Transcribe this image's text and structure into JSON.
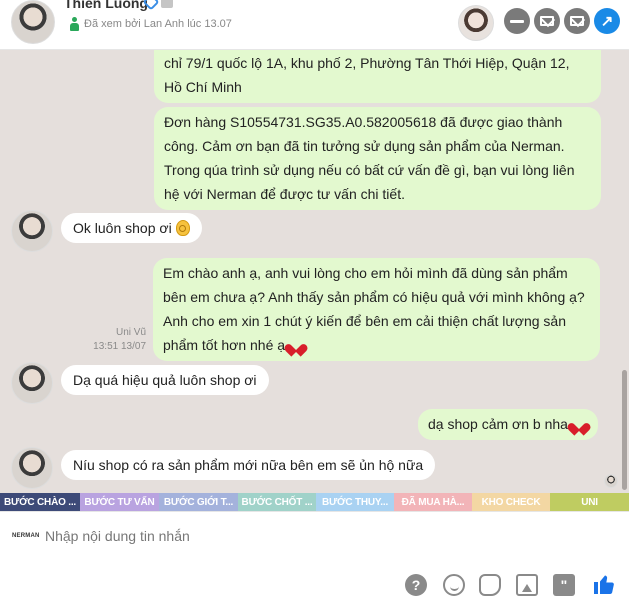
{
  "header": {
    "name": "Thien Luong",
    "seen_status": "Đã xem bởi Lan Anh lúc 13.07",
    "buttons": [
      "minus-icon",
      "mail-icon",
      "forward-mail-icon",
      "share-arrow-icon"
    ]
  },
  "messages": [
    {
      "direction": "out",
      "text": "chỉ 79/1 quốc lộ 1A, khu phố 2, Phường Tân Thới Hiệp, Quận 12, Hồ Chí Minh"
    },
    {
      "direction": "out",
      "text": "Đơn hàng S10554731.SG35.A0.582005618 đã được giao thành công. Cảm ơn bạn đã tin tưởng sử dụng sản phẩm của Nerman. Trong qúa trình sử dụng nếu có bất cứ vấn đề gì, bạn vui lòng liên hệ với Nerman để được tư vấn chi tiết."
    },
    {
      "direction": "in",
      "text": "Ok luôn shop ơi",
      "emoji": "ok-hand"
    },
    {
      "direction": "out",
      "text": "Em chào anh ạ, anh vui lòng cho em hỏi mình đã dùng sản phẩm bên em chưa ạ? Anh thấy sản phẩm có hiệu quả với mình không ạ? Anh cho em xin 1 chút ý kiến để bên em cải thiện chất lượng sản phẩm tốt hơn nhé ạ",
      "emoji": "heart",
      "sender": "Uni Vũ",
      "time": "13:51 13/07"
    },
    {
      "direction": "in",
      "text": "Dạ quá hiệu quả luôn shop ơi"
    },
    {
      "direction": "out",
      "text": "dạ shop cảm ơn b nha",
      "emoji": "heart"
    },
    {
      "direction": "in",
      "text": "Níu shop có ra sản phẩm mới nữa bên em sẽ ủn hộ nữa"
    }
  ],
  "tags": [
    {
      "label": "BƯỚC CHÀO ...",
      "color": "#3d4a78"
    },
    {
      "label": "BƯỚC TƯ VẤN",
      "color": "#b9a3e0"
    },
    {
      "label": "BƯỚC GIỚI T...",
      "color": "#a4b2dc"
    },
    {
      "label": "BƯỚC CHỐT ...",
      "color": "#a0d2c9"
    },
    {
      "label": "BƯỚC THUY...",
      "color": "#a9d2f2"
    },
    {
      "label": "ĐÃ MUA HÀ...",
      "color": "#f2b4b8"
    },
    {
      "label": "KHO CHECK",
      "color": "#f3d7a3"
    },
    {
      "label": "UNI",
      "color": "#bfcc61"
    }
  ],
  "composer": {
    "brand": "NERMAN",
    "placeholder": "Nhập nội dung tin nhắn",
    "tools": [
      "help-icon",
      "smile-icon",
      "sticker-icon",
      "image-icon",
      "quote-icon",
      "like-icon"
    ]
  }
}
